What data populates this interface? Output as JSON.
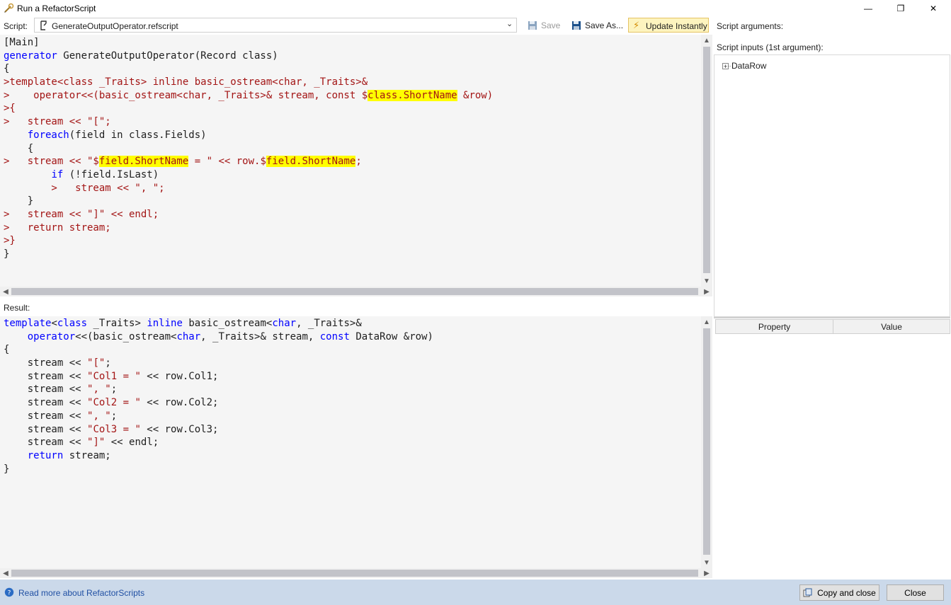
{
  "window": {
    "title": "Run a RefactorScript",
    "minimize_glyph": "—",
    "restore_glyph": "❐",
    "close_glyph": "✕"
  },
  "toolbar": {
    "script_label": "Script:",
    "script_file": "GenerateOutputOperator.refscript",
    "save_label": "Save",
    "save_as_label": "Save As...",
    "update_label": "Update Instantly",
    "script_arguments_label": "Script arguments:"
  },
  "script_inputs": {
    "label": "Script inputs (1st argument):",
    "tree_items": [
      {
        "expander": "+",
        "label": "DataRow"
      }
    ]
  },
  "property_grid": {
    "columns": [
      "Property",
      "Value"
    ]
  },
  "result_label": "Result:",
  "status": {
    "link": "Read more about RefactorScripts",
    "copy_close": "Copy and close",
    "close": "Close"
  },
  "colors": {
    "keyword": "#0000ff",
    "string": "#a31515",
    "highlight": "#ffff00",
    "statusbar": "#cbd9ea",
    "update_button_bg": "#fdf4bf"
  },
  "script_lines": [
    [
      [
        "t",
        "[Main]"
      ]
    ],
    [
      [
        "k",
        "generator"
      ],
      [
        "t",
        " GenerateOutputOperator(Record class)"
      ]
    ],
    [
      [
        "t",
        "{"
      ]
    ],
    [
      [
        "g",
        ">template<class _Traits> inline basic_ostream<char, _Traits>&"
      ]
    ],
    [
      [
        "g",
        ">    operator<<(basic_ostream<char, _Traits>& stream, const $"
      ],
      [
        "h",
        "class.ShortName"
      ],
      [
        "g",
        " &row)"
      ]
    ],
    [
      [
        "g",
        ">{"
      ]
    ],
    [
      [
        "g",
        ">   stream << \"[\";"
      ]
    ],
    [
      [
        "t",
        "    "
      ],
      [
        "k",
        "foreach"
      ],
      [
        "t",
        "(field in class.Fields)"
      ]
    ],
    [
      [
        "t",
        "    {"
      ]
    ],
    [
      [
        "g",
        ">   stream << \"$"
      ],
      [
        "h",
        "field.ShortName"
      ],
      [
        "g",
        " = \" << row.$"
      ],
      [
        "h",
        "field.ShortName"
      ],
      [
        "g",
        ";"
      ]
    ],
    [
      [
        "t",
        "        "
      ],
      [
        "k",
        "if"
      ],
      [
        "t",
        " (!field.IsLast)"
      ]
    ],
    [
      [
        "g",
        "        >   stream << \", \";"
      ]
    ],
    [
      [
        "t",
        "    }"
      ]
    ],
    [
      [
        "g",
        ">   stream << \"]\" << endl;"
      ]
    ],
    [
      [
        "g",
        ">   return stream;"
      ]
    ],
    [
      [
        "g",
        ">}"
      ]
    ],
    [
      [
        "t",
        "}"
      ]
    ]
  ],
  "result_lines": [
    [
      [
        "k",
        "template"
      ],
      [
        "t",
        "<"
      ],
      [
        "k",
        "class"
      ],
      [
        "t",
        " _Traits> "
      ],
      [
        "k",
        "inline"
      ],
      [
        "t",
        " basic_ostream<"
      ],
      [
        "k",
        "char"
      ],
      [
        "t",
        ", _Traits>&"
      ]
    ],
    [
      [
        "t",
        "    "
      ],
      [
        "k",
        "operator"
      ],
      [
        "t",
        "<<(basic_ostream<"
      ],
      [
        "k",
        "char"
      ],
      [
        "t",
        ", _Traits>& stream, "
      ],
      [
        "k",
        "const"
      ],
      [
        "t",
        " DataRow &row)"
      ]
    ],
    [
      [
        "t",
        "{"
      ]
    ],
    [
      [
        "t",
        "    stream << "
      ],
      [
        "s",
        "\"[\""
      ],
      [
        "t",
        ";"
      ]
    ],
    [
      [
        "t",
        "    stream << "
      ],
      [
        "s",
        "\"Col1 = \""
      ],
      [
        "t",
        " << row.Col1;"
      ]
    ],
    [
      [
        "t",
        "    stream << "
      ],
      [
        "s",
        "\", \""
      ],
      [
        "t",
        ";"
      ]
    ],
    [
      [
        "t",
        "    stream << "
      ],
      [
        "s",
        "\"Col2 = \""
      ],
      [
        "t",
        " << row.Col2;"
      ]
    ],
    [
      [
        "t",
        "    stream << "
      ],
      [
        "s",
        "\", \""
      ],
      [
        "t",
        ";"
      ]
    ],
    [
      [
        "t",
        "    stream << "
      ],
      [
        "s",
        "\"Col3 = \""
      ],
      [
        "t",
        " << row.Col3;"
      ]
    ],
    [
      [
        "t",
        "    stream << "
      ],
      [
        "s",
        "\"]\""
      ],
      [
        "t",
        " << endl;"
      ]
    ],
    [
      [
        "t",
        "    "
      ],
      [
        "k",
        "return"
      ],
      [
        "t",
        " stream;"
      ]
    ],
    [
      [
        "t",
        "}"
      ]
    ]
  ]
}
